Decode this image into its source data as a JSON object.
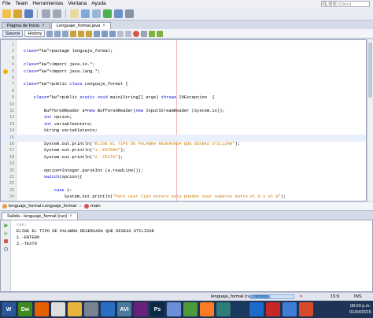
{
  "menubar": {
    "items": [
      "File",
      "Team",
      "Herramientas",
      "Ventana",
      "Ayuda"
    ],
    "search_placeholder": "搜索 (Ctrl+I)"
  },
  "tabs": [
    {
      "label": "Página de Inicio",
      "active": false
    },
    {
      "label": "Lenguaje_formal.java",
      "active": true
    }
  ],
  "editor_toolbar": {
    "source_label": "Source",
    "history_label": "History"
  },
  "code_lines": [
    {
      "n": "1",
      "text": ""
    },
    {
      "n": "2",
      "text": "package lenguaje_formal;"
    },
    {
      "n": "3",
      "text": ""
    },
    {
      "n": "4",
      "text": "import java.io.*;"
    },
    {
      "n": "5",
      "text": "import java.lang.*;"
    },
    {
      "n": "6",
      "text": ""
    },
    {
      "n": "7",
      "text": "public class Lenguaje_formal {"
    },
    {
      "n": "8",
      "text": ""
    },
    {
      "n": "9",
      "text": "    public static void main(String[] args) throws IOException  {"
    },
    {
      "n": "10",
      "text": ""
    },
    {
      "n": "11",
      "text": "        BufferedReader a=new BufferedReader(new InputStreamReader (System.in));"
    },
    {
      "n": "12",
      "text": "        int opcion;"
    },
    {
      "n": "13",
      "text": "        int variableentera;"
    },
    {
      "n": "14",
      "text": "        String variabletexto;"
    },
    {
      "n": "15",
      "text": ""
    },
    {
      "n": "16",
      "text": "        System.out.println(\"ELIGE EL TIPO DE PALABRA RESERVADA QUE DESEAS UTILIZAR\");"
    },
    {
      "n": "17",
      "text": "        System.out.println(\"1.-ENTERO\");"
    },
    {
      "n": "18",
      "text": "        System.out.println(\"2.-TEXTO\");"
    },
    {
      "n": "19",
      "text": ""
    },
    {
      "n": "20",
      "text": "        opcion=Integer.parseInt (a.readLine());"
    },
    {
      "n": "21",
      "text": "        switch(opcion){"
    },
    {
      "n": "22",
      "text": ""
    },
    {
      "n": "23",
      "text": "            case 1:"
    },
    {
      "n": "24",
      "text": "                System.out.println(\"Para usar tipo entero solo puedes usar numeros entre el 0 y el 9\");"
    }
  ],
  "navigator": {
    "crumb1": "lenguaje_formal.Lenguaje_formal",
    "crumb2": "main"
  },
  "output": {
    "tab_label": "Salida - lenguaje_formal (run)",
    "lines": [
      "run:",
      "ELIGE EL TIPO DE PALABRA RESERVADA QUE DESEAS UTILIZAR",
      "1.-ENTERO",
      "2.-TEXTO"
    ]
  },
  "statusbar": {
    "task_label": "lenguaje_formal (run)",
    "progress_label": "running...",
    "progress_fraction": 0.45,
    "cursor_position": "15:9",
    "mode": "INS"
  },
  "taskbar": {
    "apps": [
      {
        "name": "word",
        "label": "W",
        "color": "#2b579a"
      },
      {
        "name": "dreamweaver",
        "label": "Dw",
        "color": "#3d8b1f"
      },
      {
        "name": "firefox",
        "label": "",
        "color": "#e66000"
      },
      {
        "name": "chrome",
        "label": "",
        "color": "#dddddd"
      },
      {
        "name": "folder",
        "label": "",
        "color": "#e7b43c"
      },
      {
        "name": "settings",
        "label": "",
        "color": "#7a8190"
      },
      {
        "name": "media",
        "label": "",
        "color": "#2a6ec2"
      },
      {
        "name": "avi",
        "label": "AVI",
        "color": "#4a7b9d"
      },
      {
        "name": "visual-studio",
        "label": "",
        "color": "#68217a"
      },
      {
        "name": "ps",
        "label": "Ps",
        "color": "#0a2a48"
      },
      {
        "name": "paint",
        "label": "",
        "color": "#6a8fd6"
      },
      {
        "name": "app-green",
        "label": "",
        "color": "#4c9a3a"
      },
      {
        "name": "xampp",
        "label": "",
        "color": "#fb7a24"
      },
      {
        "name": "app-teal",
        "label": "",
        "color": "#2e7d7a"
      },
      {
        "name": "virtualbox",
        "label": "",
        "color": "#183a61"
      },
      {
        "name": "netbeans",
        "label": "",
        "color": "#1b6ac9"
      },
      {
        "name": "app-red",
        "label": "",
        "color": "#c62828"
      },
      {
        "name": "app-blue",
        "label": "",
        "color": "#3f7dd6"
      },
      {
        "name": "java",
        "label": "",
        "color": "#d64a2a"
      }
    ],
    "clock_time": "08:03 p.m.",
    "clock_date": "01/04/2015"
  }
}
